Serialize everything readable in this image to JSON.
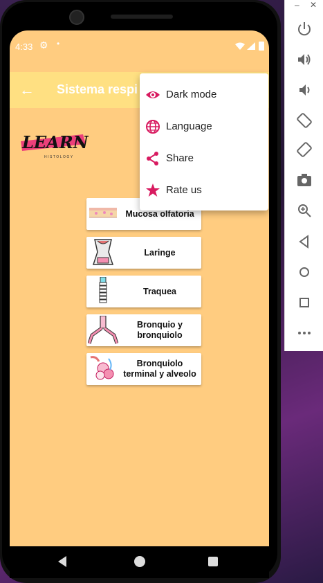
{
  "status_bar": {
    "time": "4:33"
  },
  "toolbar": {
    "title": "Sistema respi"
  },
  "logo": {
    "text": "LEARN",
    "subtitle": "HISTOLOGY"
  },
  "items": [
    {
      "label": "Mucosa olfatoria"
    },
    {
      "label": "Laringe"
    },
    {
      "label": "Traquea"
    },
    {
      "label": "Bronquio y bronquiolo"
    },
    {
      "label": "Bronquiolo terminal y alveolo"
    }
  ],
  "menu": {
    "items": [
      {
        "label": "Dark mode",
        "icon": "eye-icon"
      },
      {
        "label": "Language",
        "icon": "globe-icon"
      },
      {
        "label": "Share",
        "icon": "share-icon"
      },
      {
        "label": "Rate us",
        "icon": "star-icon"
      }
    ],
    "accent": "#D81B60"
  },
  "colors": {
    "background": "#FFCC80",
    "toolbar": "#FFE082",
    "accent": "#D81B60"
  },
  "emulator": {
    "buttons": [
      "power-icon",
      "volume-up-icon",
      "volume-down-icon",
      "rotate-left-icon",
      "rotate-right-icon",
      "camera-icon",
      "zoom-icon",
      "back-icon",
      "home-icon",
      "overview-icon",
      "more-icon"
    ]
  }
}
